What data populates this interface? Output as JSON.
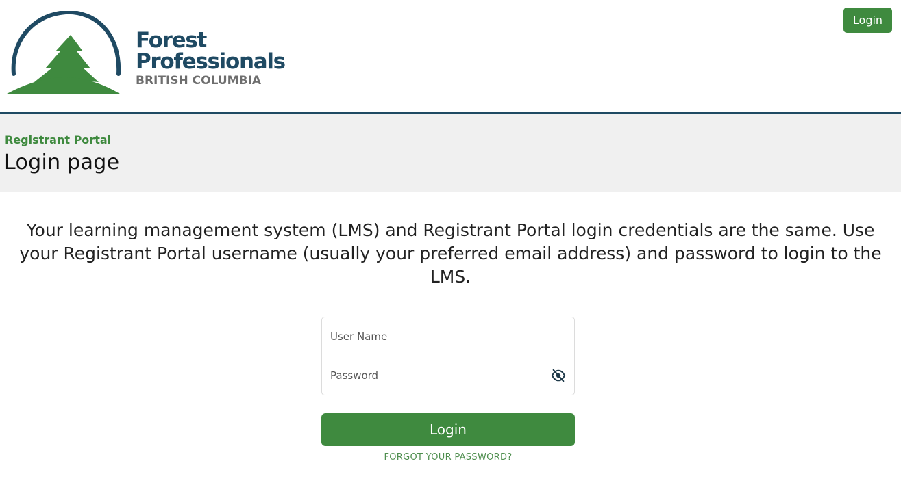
{
  "brand": {
    "line1": "Forest",
    "line2": "Professionals",
    "line3": "BRITISH COLUMBIA",
    "colors": {
      "navy": "#1f4a63",
      "green": "#3f8a3f",
      "gray": "#6e6e6e"
    }
  },
  "header": {
    "login_label": "Login"
  },
  "title_band": {
    "portal_label": "Registrant Portal",
    "page_title": "Login page"
  },
  "intro_text": "Your learning management system (LMS) and Registrant Portal login credentials are the same. Use your Registrant Portal username (usually your preferred email address) and password to login to the LMS.",
  "form": {
    "username_placeholder": "User Name",
    "username_value": "",
    "password_placeholder": "Password",
    "password_value": "",
    "password_toggle_icon": "eye-slash-icon",
    "login_label": "Login",
    "forgot_label": "FORGOT YOUR PASSWORD?"
  }
}
